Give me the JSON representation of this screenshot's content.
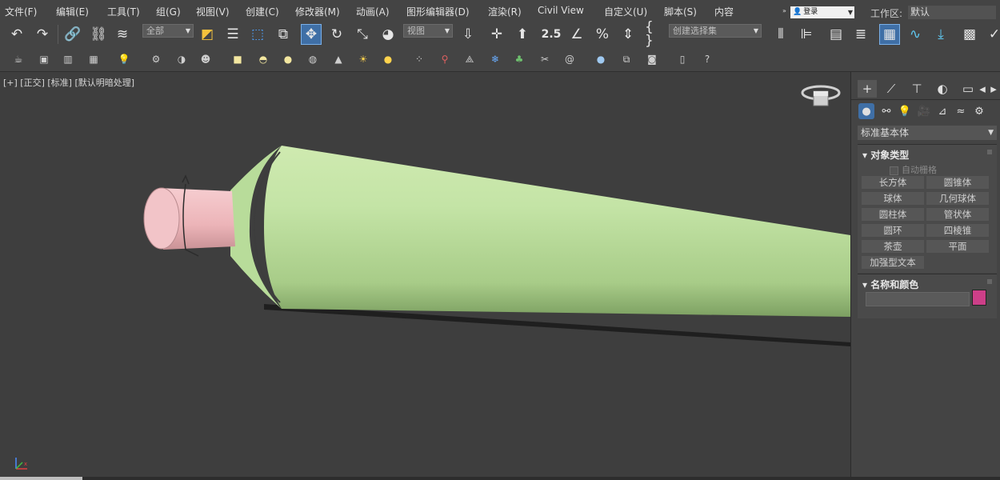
{
  "menubar": {
    "items": [
      "文件(F)",
      "编辑(E)",
      "工具(T)",
      "组(G)",
      "视图(V)",
      "创建(C)",
      "修改器(M)",
      "动画(A)",
      "图形编辑器(D)",
      "渲染(R)",
      "Civil View",
      "自定义(U)",
      "脚本(S)",
      "内容"
    ],
    "login": "登录",
    "workspace_label": "工作区:",
    "workspace_value": "默认"
  },
  "toolbar1": {
    "selection_filter": "全部",
    "ref_coord": "视图",
    "named_selection_placeholder": "创建选择集",
    "snap_label": "2.5"
  },
  "viewport": {
    "label": "[+] [正交] [标准] [默认明暗处理]",
    "object_colors": {
      "tube_body": "#bfe29e",
      "tube_shadow": "#7aa05e",
      "cap": "#f0bcc0",
      "background": "#3e3e3e"
    }
  },
  "command_panel": {
    "category": "标准基本体",
    "object_type": {
      "title": "对象类型",
      "autogrid": "自动栅格",
      "buttons": [
        "长方体",
        "圆锥体",
        "球体",
        "几何球体",
        "圆柱体",
        "管状体",
        "圆环",
        "四棱锥",
        "茶壶",
        "平面",
        "加强型文本"
      ]
    },
    "name_color": {
      "title": "名称和颜色",
      "name_value": "",
      "color": "#cc3f88"
    }
  }
}
